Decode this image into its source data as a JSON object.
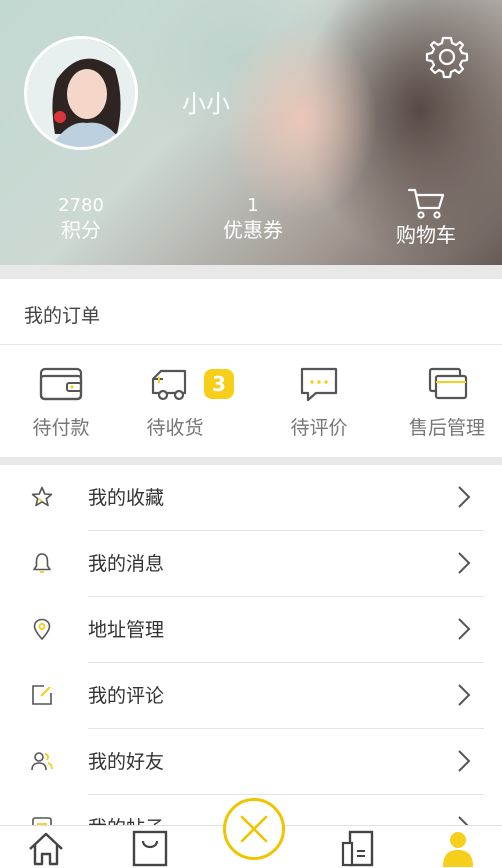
{
  "profile": {
    "username": "小小",
    "avatar_icon": "user-avatar-photo",
    "settings_icon": "gear-icon"
  },
  "stats": {
    "points_value": "2780",
    "points_label": "积分",
    "coupons_value": "1",
    "coupons_label": "优惠券",
    "cart_label": "购物车",
    "cart_icon": "cart-icon"
  },
  "orders": {
    "title": "我的订单",
    "items": [
      {
        "label": "待付款",
        "icon": "wallet-icon"
      },
      {
        "label": "待收货",
        "icon": "truck-icon",
        "badge": "3"
      },
      {
        "label": "待评价",
        "icon": "chat-bubble-icon"
      },
      {
        "label": "售后管理",
        "icon": "stacked-cards-icon"
      }
    ]
  },
  "menu": {
    "items": [
      {
        "label": "我的收藏",
        "icon": "star-icon"
      },
      {
        "label": "我的消息",
        "icon": "bell-icon"
      },
      {
        "label": "地址管理",
        "icon": "location-pin-icon"
      },
      {
        "label": "我的评论",
        "icon": "edit-icon"
      },
      {
        "label": "我的好友",
        "icon": "friends-icon"
      },
      {
        "label": "我的帖子",
        "icon": "post-icon"
      }
    ]
  },
  "tabbar": {
    "items": [
      {
        "icon": "home-icon"
      },
      {
        "icon": "shopping-bag-icon"
      },
      {
        "icon": "center-x-icon"
      },
      {
        "icon": "document-icon"
      },
      {
        "icon": "person-icon",
        "active": true
      }
    ],
    "accent_color": "#f7cf1a"
  },
  "colors": {
    "accent": "#f7cf1a",
    "text_primary": "#333333",
    "text_secondary": "#777777"
  }
}
